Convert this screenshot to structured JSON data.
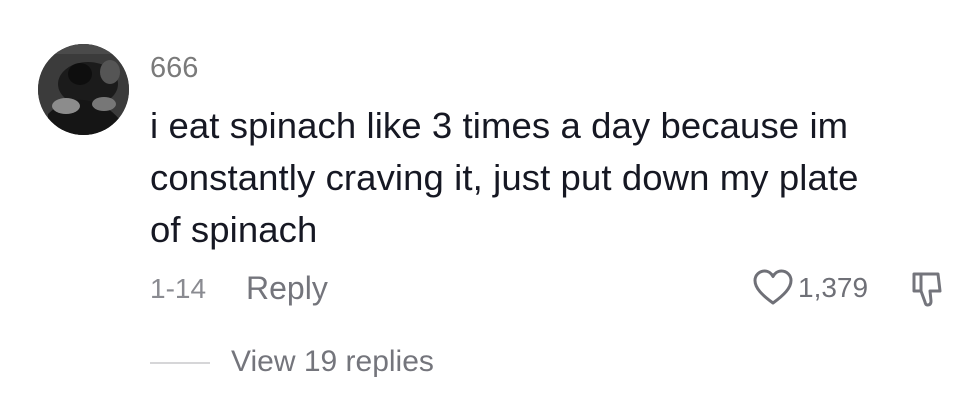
{
  "comment": {
    "avatar_icon": "user-avatar-photo",
    "username": "666",
    "text_lines": [
      "i eat spinach like 3 times a day because im",
      "constantly craving it, just put down my plate",
      "of spinach"
    ],
    "date": "1-14",
    "reply_label": "Reply",
    "like_icon": "heart-outline-icon",
    "like_count": "1,379",
    "dislike_icon": "thumbs-down-icon",
    "view_replies_label": "View 19 replies"
  },
  "colors": {
    "text_primary": "#161823",
    "text_secondary": "#74757c",
    "divider": "#d6d6d8"
  }
}
